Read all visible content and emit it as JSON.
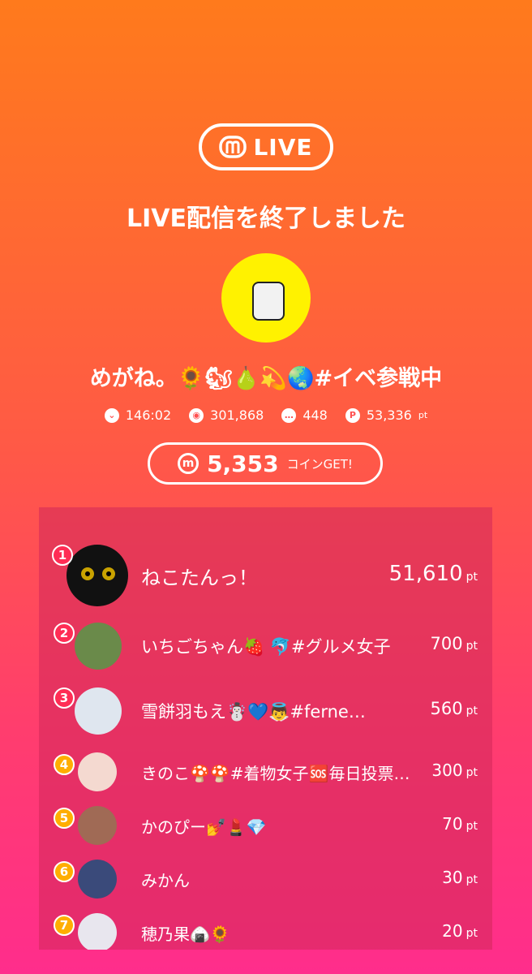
{
  "header": {
    "logo_text": "LIVE",
    "title": "LIVE配信を終了しました"
  },
  "streamer": {
    "name": "めがね。🌻🐿🍐💫🌏#イベ参戦中",
    "avatar_bg": "#fff200"
  },
  "stats": {
    "duration": "146:02",
    "views": "301,868",
    "comments": "448",
    "points": "53,336",
    "points_unit": "pt"
  },
  "coins": {
    "value": "5,353",
    "suffix": "コインGET!"
  },
  "ranking": [
    {
      "rank": "1",
      "name": "ねこたんっ！",
      "points": "51,610",
      "unit": "pt",
      "badge_color": "#ff2d55",
      "avatar_color": "#111111"
    },
    {
      "rank": "2",
      "name": "いちごちゃん🍓 🐬#グルメ女子",
      "points": "700",
      "unit": "pt",
      "badge_color": "#ff2d55",
      "avatar_color": "#6a8a4a"
    },
    {
      "rank": "3",
      "name": "雪餅羽もえ☃️💙👼#ferne…",
      "points": "560",
      "unit": "pt",
      "badge_color": "#ff2d55",
      "avatar_color": "#dfe6ef"
    },
    {
      "rank": "4",
      "name": "きのこ🍄🍄#着物女子🆘毎日投票…",
      "points": "300",
      "unit": "pt",
      "badge_color": "#ffae00",
      "avatar_color": "#f4d9d0"
    },
    {
      "rank": "5",
      "name": "かのぴー💅💄💎",
      "points": "70",
      "unit": "pt",
      "badge_color": "#ffae00",
      "avatar_color": "#a06a55"
    },
    {
      "rank": "6",
      "name": "みかん",
      "points": "30",
      "unit": "pt",
      "badge_color": "#ffae00",
      "avatar_color": "#3a4a7a"
    },
    {
      "rank": "7",
      "name": "穂乃果🍙🌻",
      "points": "20",
      "unit": "pt",
      "badge_color": "#ffae00",
      "avatar_color": "#e8e6ee"
    }
  ]
}
